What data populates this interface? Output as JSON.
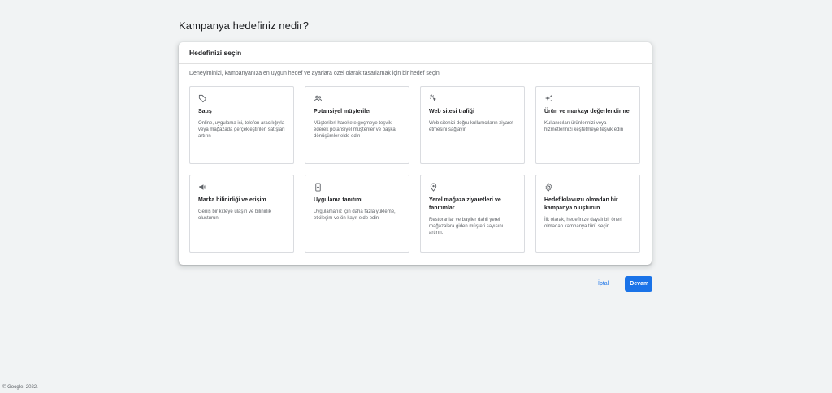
{
  "page": {
    "title": "Kampanya hedefiniz nedir?",
    "footer": "© Google, 2022."
  },
  "panel": {
    "header": "Hedefinizi seçin",
    "description": "Deneyiminizi, kampanyanıza en uygun hedef ve ayarlara özel olarak tasarlamak için bir hedef seçin"
  },
  "goals": [
    {
      "icon": "tag-icon",
      "title": "Satış",
      "desc": "Online, uygulama içi, telefon aracılığıyla veya mağazada gerçekleştirilen satışları artırın"
    },
    {
      "icon": "people-icon",
      "title": "Potansiyel müşteriler",
      "desc": "Müşterileri harekete geçmeye teşvik ederek potansiyel müşteriler ve başka dönüşümler elde edin"
    },
    {
      "icon": "cursor-click-icon",
      "title": "Web sitesi trafiği",
      "desc": "Web sitenizi doğru kullanıcıların ziyaret etmesini sağlayın"
    },
    {
      "icon": "sparkle-icon",
      "title": "Ürün ve markayı değerlendirme",
      "desc": "Kullanıcıları ürünlerinizi veya hizmetlerinizi keşfetmeye teşvik edin"
    },
    {
      "icon": "megaphone-icon",
      "title": "Marka bilinirliği ve erişim",
      "desc": "Geniş bir kitleye ulaşın ve bilinirlik oluşturun"
    },
    {
      "icon": "phone-download-icon",
      "title": "Uygulama tanıtımı",
      "desc": "Uygulamanız için daha fazla yükleme, etkileşim ve ön kayıt elde edin"
    },
    {
      "icon": "location-pin-icon",
      "title": "Yerel mağaza ziyaretleri ve tanıtımlar",
      "desc": "Restoranlar ve bayiler dahil yerel mağazalara giden müşteri sayısını artırın."
    },
    {
      "icon": "gear-icon",
      "title": "Hedef kılavuzu olmadan bir kampanya oluşturun",
      "desc": "İlk olarak, hedefinize dayalı bir öneri olmadan kampanya türü seçin."
    }
  ],
  "actions": {
    "cancel": "İptal",
    "continue": "Devam"
  },
  "colors": {
    "accent": "#1a73e8",
    "background": "#f1f3f4"
  }
}
